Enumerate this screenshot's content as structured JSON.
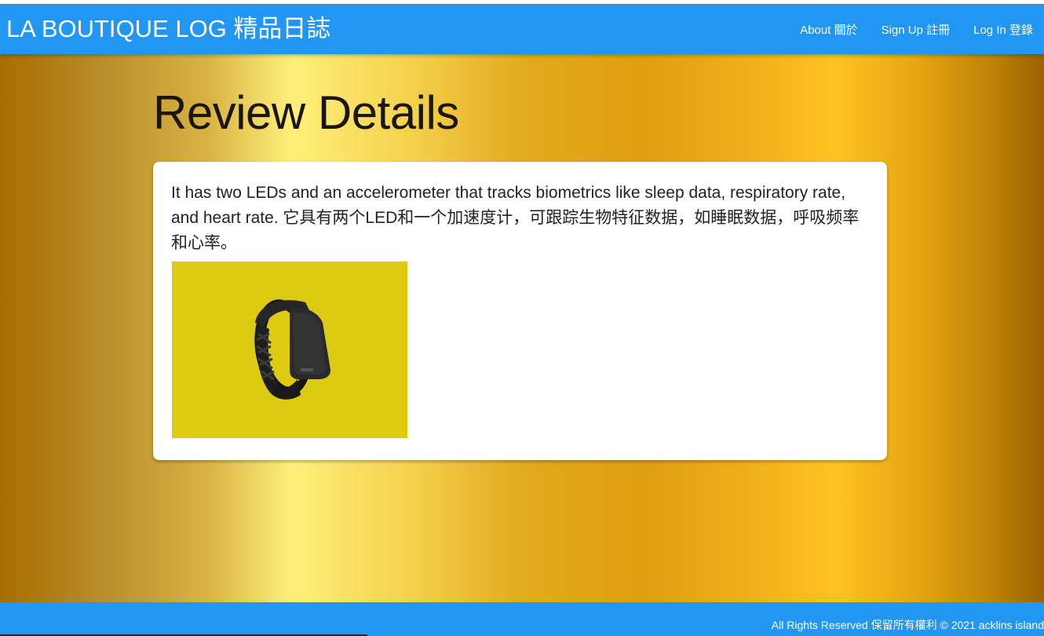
{
  "navbar": {
    "brand": "LA BOUTIQUE LOG 精品日誌",
    "links": [
      "About 關於",
      "Sign Up 註冊",
      "Log In 登錄"
    ],
    "background_color": "#2196f3"
  },
  "main": {
    "title": "Review Details",
    "review": {
      "text": "It has two LEDs and an accelerometer that tracks biometrics like sleep data, respiratory rate, and heart rate. 它具有两个LED和一个加速度计，可跟踪生物特征数据，如睡眠数据，呼吸频率和心率。",
      "image_description": "black-fitness-band-photo",
      "image_background_color": "#ddcb12"
    }
  },
  "footer": {
    "text": "All Rights Reserved 保留所有權利 © 2021 acklins island"
  }
}
